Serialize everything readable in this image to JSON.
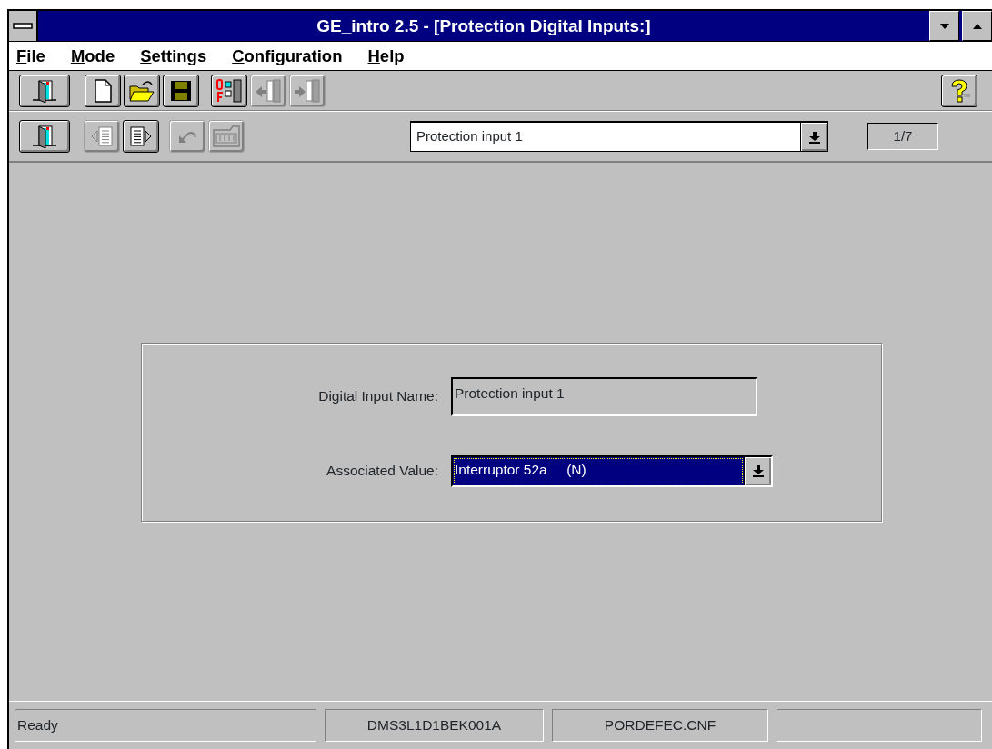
{
  "window": {
    "title": "GE_intro 2.5 - [Protection Digital Inputs:]"
  },
  "menu": [
    {
      "label": "File"
    },
    {
      "label": "Mode"
    },
    {
      "label": "Settings"
    },
    {
      "label": "Configuration"
    },
    {
      "label": "Help"
    }
  ],
  "toolbar": [
    {
      "kind": "exit",
      "disabled": false
    },
    {
      "kind": "new",
      "disabled": false
    },
    {
      "kind": "open",
      "disabled": false
    },
    {
      "kind": "save",
      "disabled": false
    },
    {
      "kind": "onoff",
      "disabled": false
    },
    {
      "kind": "import",
      "disabled": true
    },
    {
      "kind": "export",
      "disabled": true
    }
  ],
  "navbar": {
    "buttons": [
      {
        "kind": "exit",
        "disabled": false
      },
      {
        "kind": "prev",
        "disabled": true
      },
      {
        "kind": "next",
        "disabled": false
      },
      {
        "kind": "undo",
        "disabled": true
      },
      {
        "kind": "store",
        "disabled": true
      }
    ],
    "selector": {
      "value": "Protection input 1"
    },
    "counter": "1/7"
  },
  "form": {
    "fields": [
      {
        "kind": "text",
        "label": "Digital Input Name:",
        "value": "Protection input 1"
      },
      {
        "kind": "dropdown",
        "label": "Associated Value:",
        "value": "Interruptor 52a     (N)"
      }
    ]
  },
  "status_bar": [
    {
      "text": "Ready"
    },
    {
      "text": "DMS3L1D1BEK001A"
    },
    {
      "text": "PORDEFEC.CNF"
    }
  ]
}
